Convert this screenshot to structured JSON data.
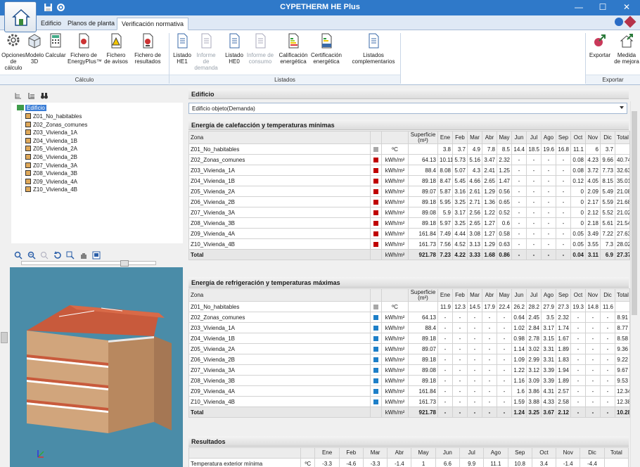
{
  "window": {
    "title": "CYPETHERM HE Plus"
  },
  "tabs": [
    "Edificio",
    "Planos de planta",
    "Verificación normativa"
  ],
  "ribbon": {
    "calculo": {
      "label": "Cálculo",
      "buttons": [
        {
          "l1": "Opciones",
          "l2": "de cálculo"
        },
        {
          "l1": "Modelo",
          "l2": "3D"
        },
        {
          "l1": "Calcular",
          "l2": ""
        },
        {
          "l1": "Fichero de",
          "l2": "EnergyPlus™"
        },
        {
          "l1": "Fichero",
          "l2": "de avisos"
        },
        {
          "l1": "Fichero de",
          "l2": "resultados"
        }
      ]
    },
    "listados": {
      "label": "Listados",
      "buttons": [
        {
          "l1": "Listado",
          "l2": "HE1",
          "dis": false
        },
        {
          "l1": "Informe de",
          "l2": "demanda",
          "dis": true
        },
        {
          "l1": "Listado",
          "l2": "HE0",
          "dis": false
        },
        {
          "l1": "Informe de",
          "l2": "consumo",
          "dis": true
        },
        {
          "l1": "Calificación",
          "l2": "energética",
          "dis": false
        },
        {
          "l1": "Certificación",
          "l2": "energética",
          "dis": false
        },
        {
          "l1": "Listados",
          "l2": "complementarios",
          "dis": false
        }
      ]
    },
    "exportar": {
      "label": "Exportar",
      "buttons": [
        {
          "l1": "Exportar",
          "l2": ""
        },
        {
          "l1": "Medida",
          "l2": "de mejora"
        }
      ]
    }
  },
  "tree": {
    "root": "Edificio",
    "items": [
      "Z01_No_habitables",
      "Z02_Zonas_comunes",
      "Z03_Vivienda_1A",
      "Z04_Vivienda_1B",
      "Z05_Vivienda_2A",
      "Z06_Vivienda_2B",
      "Z07_Vivienda_3A",
      "Z08_Vivienda_3B",
      "Z09_Vivienda_4A",
      "Z10_Vivienda_4B"
    ]
  },
  "content": {
    "header": "Edificio",
    "selector_value": "Edificio objeto(Demanda)",
    "months": [
      "Ene",
      "Feb",
      "Mar",
      "Abr",
      "May",
      "Jun",
      "Jul",
      "Ago",
      "Sep",
      "Oct",
      "Nov",
      "Dic",
      "Total"
    ],
    "zone_header": "Zona",
    "surface_header": "Superficie (m²)",
    "heating": {
      "title": "Energía de calefacción y temperaturas mínimas",
      "color": "#c00000",
      "rows": [
        {
          "zone": "Z01_No_habitables",
          "unit": "ºC",
          "area": "",
          "vals": [
            "3.8",
            "3.7",
            "4.9",
            "7.8",
            "8.5",
            "14.4",
            "18.5",
            "19.6",
            "16.8",
            "11.1",
            "6",
            "3.7",
            ""
          ],
          "sw": "#a8a8a8"
        },
        {
          "zone": "Z02_Zonas_comunes",
          "unit": "kWh/m²",
          "area": "64.13",
          "vals": [
            "10.11",
            "5.73",
            "5.16",
            "3.47",
            "2.32",
            "-",
            "-",
            "-",
            "-",
            "0.08",
            "4.23",
            "9.66",
            "40.74"
          ]
        },
        {
          "zone": "Z03_Vivienda_1A",
          "unit": "kWh/m²",
          "area": "88.4",
          "vals": [
            "8.08",
            "5.07",
            "4.3",
            "2.41",
            "1.25",
            "-",
            "-",
            "-",
            "-",
            "0.08",
            "3.72",
            "7.73",
            "32.63"
          ]
        },
        {
          "zone": "Z04_Vivienda_1B",
          "unit": "kWh/m²",
          "area": "89.18",
          "vals": [
            "8.47",
            "5.45",
            "4.66",
            "2.65",
            "1.47",
            "-",
            "-",
            "-",
            "-",
            "0.12",
            "4.05",
            "8.15",
            "35.01"
          ]
        },
        {
          "zone": "Z05_Vivienda_2A",
          "unit": "kWh/m²",
          "area": "89.07",
          "vals": [
            "5.87",
            "3.16",
            "2.61",
            "1.29",
            "0.56",
            "-",
            "-",
            "-",
            "-",
            "0",
            "2.09",
            "5.49",
            "21.08"
          ]
        },
        {
          "zone": "Z06_Vivienda_2B",
          "unit": "kWh/m²",
          "area": "89.18",
          "vals": [
            "5.95",
            "3.25",
            "2.71",
            "1.36",
            "0.65",
            "-",
            "-",
            "-",
            "-",
            "0",
            "2.17",
            "5.59",
            "21.68"
          ]
        },
        {
          "zone": "Z07_Vivienda_3A",
          "unit": "kWh/m²",
          "area": "89.08",
          "vals": [
            "5.9",
            "3.17",
            "2.56",
            "1.22",
            "0.52",
            "-",
            "-",
            "-",
            "-",
            "0",
            "2.12",
            "5.52",
            "21.02"
          ]
        },
        {
          "zone": "Z08_Vivienda_3B",
          "unit": "kWh/m²",
          "area": "89.18",
          "vals": [
            "5.97",
            "3.25",
            "2.65",
            "1.27",
            "0.6",
            "-",
            "-",
            "-",
            "-",
            "0",
            "2.18",
            "5.61",
            "21.54"
          ]
        },
        {
          "zone": "Z09_Vivienda_4A",
          "unit": "kWh/m²",
          "area": "161.84",
          "vals": [
            "7.49",
            "4.44",
            "3.08",
            "1.27",
            "0.58",
            "-",
            "-",
            "-",
            "-",
            "0.05",
            "3.49",
            "7.22",
            "27.63"
          ]
        },
        {
          "zone": "Z10_Vivienda_4B",
          "unit": "kWh/m²",
          "area": "161.73",
          "vals": [
            "7.56",
            "4.52",
            "3.13",
            "1.29",
            "0.63",
            "-",
            "-",
            "-",
            "-",
            "0.05",
            "3.55",
            "7.3",
            "28.02"
          ]
        }
      ],
      "total": {
        "zone": "Total",
        "unit": "kWh/m²",
        "area": "921.78",
        "vals": [
          "7.23",
          "4.22",
          "3.33",
          "1.68",
          "0.86",
          "-",
          "-",
          "-",
          "-",
          "0.04",
          "3.11",
          "6.9",
          "27.37"
        ]
      }
    },
    "cooling": {
      "title": "Energía de refrigeración y temperaturas máximas",
      "color": "#1e7fc8",
      "rows": [
        {
          "zone": "Z01_No_habitables",
          "unit": "ºC",
          "area": "",
          "vals": [
            "11.9",
            "12.3",
            "14.5",
            "17.9",
            "22.4",
            "26.2",
            "28.2",
            "27.9",
            "27.3",
            "19.3",
            "14.8",
            "11.6",
            ""
          ],
          "sw": "#a8a8a8"
        },
        {
          "zone": "Z02_Zonas_comunes",
          "unit": "kWh/m²",
          "area": "64.13",
          "vals": [
            "-",
            "-",
            "-",
            "-",
            "-",
            "0.64",
            "2.45",
            "3.5",
            "2.32",
            "-",
            "-",
            "-",
            "8.91"
          ]
        },
        {
          "zone": "Z03_Vivienda_1A",
          "unit": "kWh/m²",
          "area": "88.4",
          "vals": [
            "-",
            "-",
            "-",
            "-",
            "-",
            "1.02",
            "2.84",
            "3.17",
            "1.74",
            "-",
            "-",
            "-",
            "8.77"
          ]
        },
        {
          "zone": "Z04_Vivienda_1B",
          "unit": "kWh/m²",
          "area": "89.18",
          "vals": [
            "-",
            "-",
            "-",
            "-",
            "-",
            "0.98",
            "2.78",
            "3.15",
            "1.67",
            "-",
            "-",
            "-",
            "8.58"
          ]
        },
        {
          "zone": "Z05_Vivienda_2A",
          "unit": "kWh/m²",
          "area": "89.07",
          "vals": [
            "-",
            "-",
            "-",
            "-",
            "-",
            "1.14",
            "3.02",
            "3.31",
            "1.89",
            "-",
            "-",
            "-",
            "9.36"
          ]
        },
        {
          "zone": "Z06_Vivienda_2B",
          "unit": "kWh/m²",
          "area": "89.18",
          "vals": [
            "-",
            "-",
            "-",
            "-",
            "-",
            "1.09",
            "2.99",
            "3.31",
            "1.83",
            "-",
            "-",
            "-",
            "9.22"
          ]
        },
        {
          "zone": "Z07_Vivienda_3A",
          "unit": "kWh/m²",
          "area": "89.08",
          "vals": [
            "-",
            "-",
            "-",
            "-",
            "-",
            "1.22",
            "3.12",
            "3.39",
            "1.94",
            "-",
            "-",
            "-",
            "9.67"
          ]
        },
        {
          "zone": "Z08_Vivienda_3B",
          "unit": "kWh/m²",
          "area": "89.18",
          "vals": [
            "-",
            "-",
            "-",
            "-",
            "-",
            "1.16",
            "3.09",
            "3.39",
            "1.89",
            "-",
            "-",
            "-",
            "9.53"
          ]
        },
        {
          "zone": "Z09_Vivienda_4A",
          "unit": "kWh/m²",
          "area": "161.84",
          "vals": [
            "-",
            "-",
            "-",
            "-",
            "-",
            "1.6",
            "3.86",
            "4.31",
            "2.57",
            "-",
            "-",
            "-",
            "12.34"
          ]
        },
        {
          "zone": "Z10_Vivienda_4B",
          "unit": "kWh/m²",
          "area": "161.73",
          "vals": [
            "-",
            "-",
            "-",
            "-",
            "-",
            "1.59",
            "3.88",
            "4.33",
            "2.58",
            "-",
            "-",
            "-",
            "12.38"
          ]
        }
      ],
      "total": {
        "zone": "Total",
        "unit": "kWh/m²",
        "area": "921.78",
        "vals": [
          "-",
          "-",
          "-",
          "-",
          "-",
          "1.24",
          "3.25",
          "3.67",
          "2.12",
          "-",
          "-",
          "-",
          "10.28"
        ]
      }
    },
    "results": {
      "title": "Resultados",
      "rows": [
        {
          "label": "Temperatura exterior mínima",
          "unit": "ºC",
          "vals": [
            "-3.3",
            "-4.6",
            "-3.3",
            "-1.4",
            "1",
            "6.6",
            "9.9",
            "11.1",
            "10.8",
            "3.4",
            "-1.4",
            "-4.4",
            ""
          ]
        }
      ]
    }
  }
}
